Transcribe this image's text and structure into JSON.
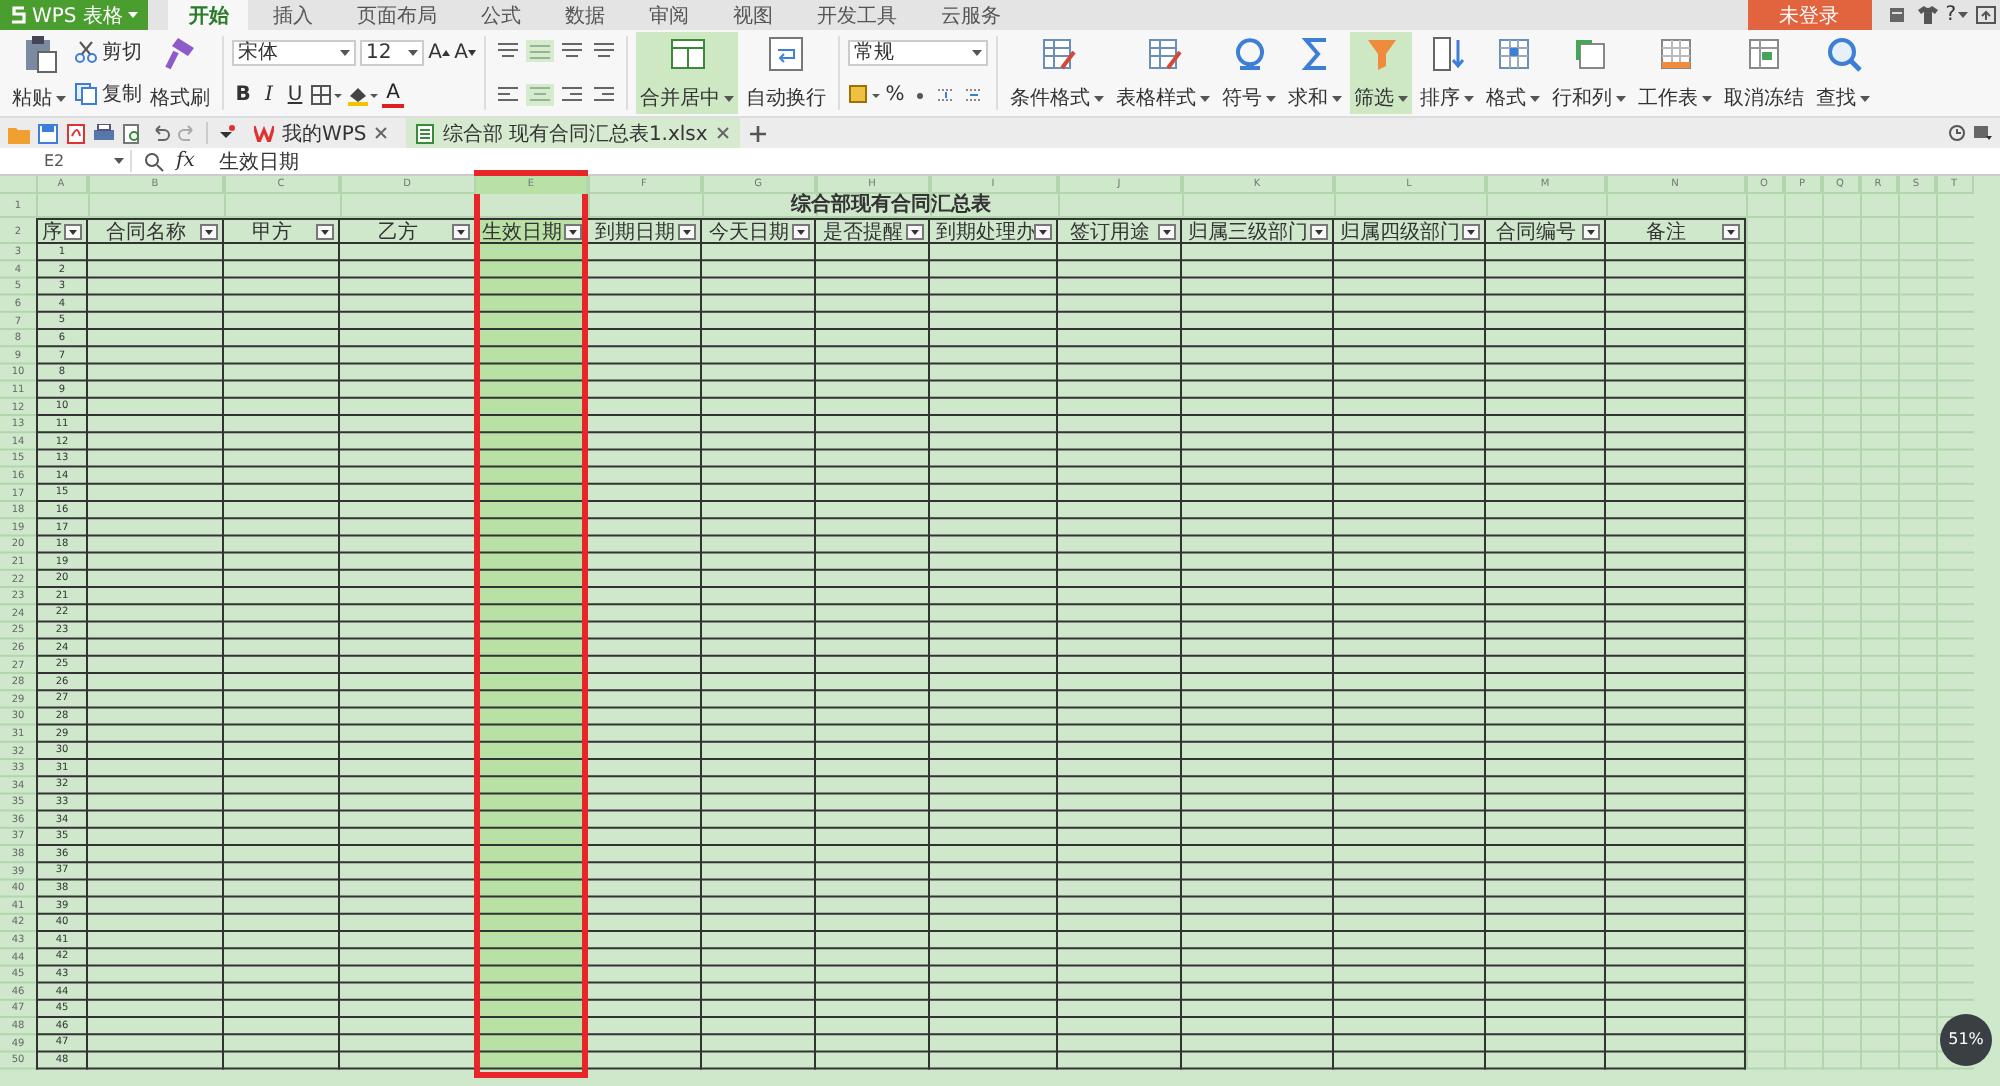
{
  "app": {
    "name": "WPS 表格"
  },
  "menu_tabs": [
    {
      "label": "开始",
      "selected": true
    },
    {
      "label": "插入",
      "selected": false
    },
    {
      "label": "页面布局",
      "selected": false
    },
    {
      "label": "公式",
      "selected": false
    },
    {
      "label": "数据",
      "selected": false
    },
    {
      "label": "审阅",
      "selected": false
    },
    {
      "label": "视图",
      "selected": false
    },
    {
      "label": "开发工具",
      "selected": false
    },
    {
      "label": "云服务",
      "selected": false
    }
  ],
  "login_button": "未登录",
  "help": "?",
  "ribbon": {
    "paste": "粘贴",
    "cut": "剪切",
    "copy": "复制",
    "format_painter": "格式刷",
    "font_name": "宋体",
    "font_size": "12",
    "grow_font": "A",
    "shrink_font": "A",
    "bold": "B",
    "italic": "I",
    "underline": "U",
    "font_color": "A",
    "merge_center": {
      "label": "合并居中",
      "active": true
    },
    "wrap_text": "自动换行",
    "number_format": "常规",
    "percent": "%",
    "tools": [
      {
        "kind": "conditional",
        "label": "条件格式",
        "active": false
      },
      {
        "kind": "table_style",
        "label": "表格样式",
        "active": false
      },
      {
        "kind": "symbol",
        "label": "符号",
        "active": false
      },
      {
        "kind": "sum",
        "label": "求和",
        "active": false
      },
      {
        "kind": "filter",
        "label": "筛选",
        "active": true
      },
      {
        "kind": "sort",
        "label": "排序",
        "active": false
      },
      {
        "kind": "format",
        "label": "格式",
        "active": false
      },
      {
        "kind": "rows_cols",
        "label": "行和列",
        "active": false
      },
      {
        "kind": "sheet",
        "label": "工作表",
        "active": false
      },
      {
        "kind": "unfreeze",
        "label": "取消冻结",
        "active": false
      },
      {
        "kind": "find",
        "label": "查找",
        "active": false
      }
    ]
  },
  "doc_tabs": [
    {
      "label": "我的WPS",
      "selected": false
    },
    {
      "label": "综合部 现有合同汇总表1.xlsx",
      "selected": true
    }
  ],
  "formula_bar": {
    "name_box": "E2",
    "fx": "fx",
    "formula": "生效日期"
  },
  "sheet": {
    "columns": [
      {
        "letter": "A",
        "selected": false
      },
      {
        "letter": "B",
        "selected": false
      },
      {
        "letter": "C",
        "selected": false
      },
      {
        "letter": "D",
        "selected": false
      },
      {
        "letter": "E",
        "selected": true
      },
      {
        "letter": "F",
        "selected": false
      },
      {
        "letter": "G",
        "selected": false
      },
      {
        "letter": "H",
        "selected": false
      },
      {
        "letter": "I",
        "selected": false
      },
      {
        "letter": "J",
        "selected": false
      },
      {
        "letter": "K",
        "selected": false
      },
      {
        "letter": "L",
        "selected": false
      },
      {
        "letter": "M",
        "selected": false
      },
      {
        "letter": "N",
        "selected": false
      },
      {
        "letter": "O",
        "selected": false
      },
      {
        "letter": "P",
        "selected": false
      },
      {
        "letter": "Q",
        "selected": false
      },
      {
        "letter": "R",
        "selected": false
      },
      {
        "letter": "S",
        "selected": false
      },
      {
        "letter": "T",
        "selected": false
      }
    ],
    "title_row_number": "1",
    "title": "综合部现有合同汇总表",
    "header_row_number": "2",
    "headers": [
      "序",
      "合同名称",
      "甲方",
      "乙方",
      "生效日期",
      "到期日期",
      "今天日期",
      "是否提醒",
      "到期处理办",
      "签订用途",
      "归属三级部门",
      "归属四级部门",
      "合同编号",
      "备注"
    ],
    "rows": [
      {
        "row": "3",
        "serial": "1"
      },
      {
        "row": "4",
        "serial": "2"
      },
      {
        "row": "5",
        "serial": "3"
      },
      {
        "row": "6",
        "serial": "4"
      },
      {
        "row": "7",
        "serial": "5"
      },
      {
        "row": "8",
        "serial": "6"
      },
      {
        "row": "9",
        "serial": "7"
      },
      {
        "row": "10",
        "serial": "8"
      },
      {
        "row": "11",
        "serial": "9"
      },
      {
        "row": "12",
        "serial": "10"
      },
      {
        "row": "13",
        "serial": "11"
      },
      {
        "row": "14",
        "serial": "12"
      },
      {
        "row": "15",
        "serial": "13"
      },
      {
        "row": "16",
        "serial": "14"
      },
      {
        "row": "17",
        "serial": "15"
      },
      {
        "row": "18",
        "serial": "16"
      },
      {
        "row": "19",
        "serial": "17"
      },
      {
        "row": "20",
        "serial": "18"
      },
      {
        "row": "21",
        "serial": "19"
      },
      {
        "row": "22",
        "serial": "20"
      },
      {
        "row": "23",
        "serial": "21"
      },
      {
        "row": "24",
        "serial": "22"
      },
      {
        "row": "25",
        "serial": "23"
      },
      {
        "row": "26",
        "serial": "24"
      },
      {
        "row": "27",
        "serial": "25"
      },
      {
        "row": "28",
        "serial": "26"
      },
      {
        "row": "29",
        "serial": "27"
      },
      {
        "row": "30",
        "serial": "28"
      },
      {
        "row": "31",
        "serial": "29"
      },
      {
        "row": "32",
        "serial": "30"
      },
      {
        "row": "33",
        "serial": "31"
      },
      {
        "row": "34",
        "serial": "32"
      },
      {
        "row": "35",
        "serial": "33"
      },
      {
        "row": "36",
        "serial": "34"
      },
      {
        "row": "37",
        "serial": "35"
      },
      {
        "row": "38",
        "serial": "36"
      },
      {
        "row": "39",
        "serial": "37"
      },
      {
        "row": "40",
        "serial": "38"
      },
      {
        "row": "41",
        "serial": "39"
      },
      {
        "row": "42",
        "serial": "40"
      },
      {
        "row": "43",
        "serial": "41"
      },
      {
        "row": "44",
        "serial": "42"
      },
      {
        "row": "45",
        "serial": "43"
      },
      {
        "row": "46",
        "serial": "44"
      },
      {
        "row": "47",
        "serial": "45"
      },
      {
        "row": "48",
        "serial": "46"
      },
      {
        "row": "49",
        "serial": "47"
      },
      {
        "row": "50",
        "serial": "48"
      }
    ]
  },
  "speed_badge": "51%"
}
